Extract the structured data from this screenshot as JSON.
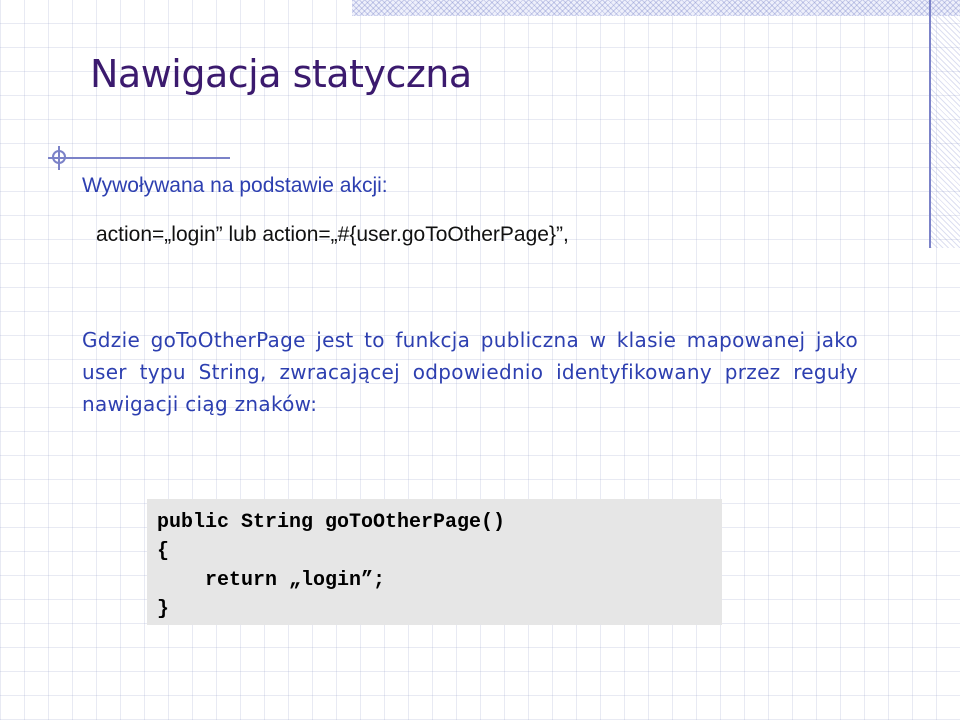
{
  "slide": {
    "title": "Nawigacja statyczna",
    "subtitle": "Wywoływana na podstawie akcji:",
    "action_line": "action=„login” lub action=„#{user.goToOtherPage}”,",
    "paragraph": "Gdzie goToOtherPage jest to funkcja publiczna w klasie mapowanej jako user typu String, zwracającej odpowiednio identyfikowany przez reguły nawigacji ciąg znaków:",
    "code": [
      "public String goToOtherPage()",
      "{",
      "    return „login”;",
      "}"
    ]
  },
  "colors": {
    "title": "#3b1a6e",
    "body_text": "#2d3fb0",
    "accent_line": "#7b82c8",
    "code_background": "#e6e6e6"
  }
}
